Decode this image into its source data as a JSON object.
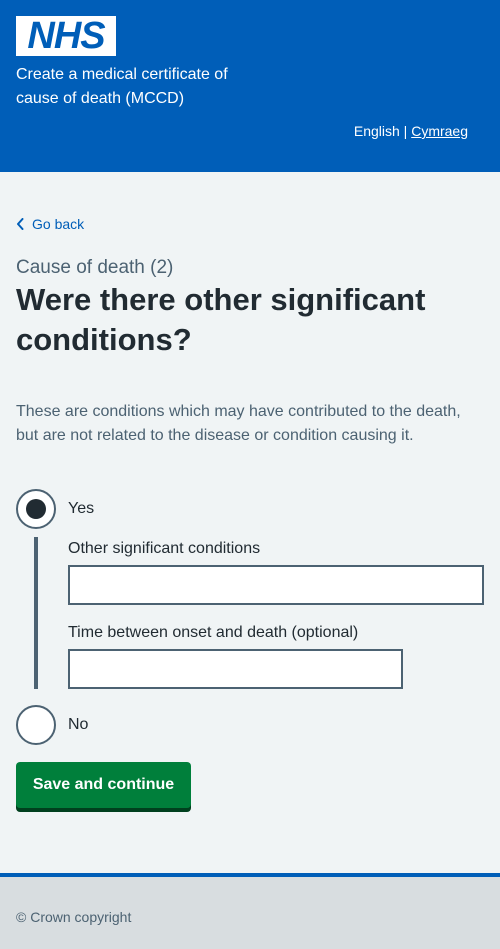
{
  "header": {
    "logo": "NHS",
    "service_name": "Create a medical certificate of cause of death (MCCD)",
    "lang_current": "English",
    "lang_separator": "|",
    "lang_other": "Cymraeg"
  },
  "nav": {
    "back_label": "Go back"
  },
  "page": {
    "caption": "Cause of death (2)",
    "heading": "Were there other significant conditions?",
    "hint": "These are conditions which may have contributed to the death, but are not related to the disease or condition causing it."
  },
  "form": {
    "options": [
      {
        "label": "Yes",
        "selected": true
      },
      {
        "label": "No",
        "selected": false
      }
    ],
    "conditions_label": "Other significant conditions",
    "conditions_value": "",
    "time_label": "Time between onset and death (optional)",
    "time_value": "",
    "submit_label": "Save and continue"
  },
  "footer": {
    "copyright": "© Crown copyright"
  },
  "colors": {
    "brand_blue": "#005eb8",
    "button_green": "#007f3b",
    "background": "#f0f4f5",
    "text": "#212b32",
    "secondary_text": "#4c6272"
  }
}
